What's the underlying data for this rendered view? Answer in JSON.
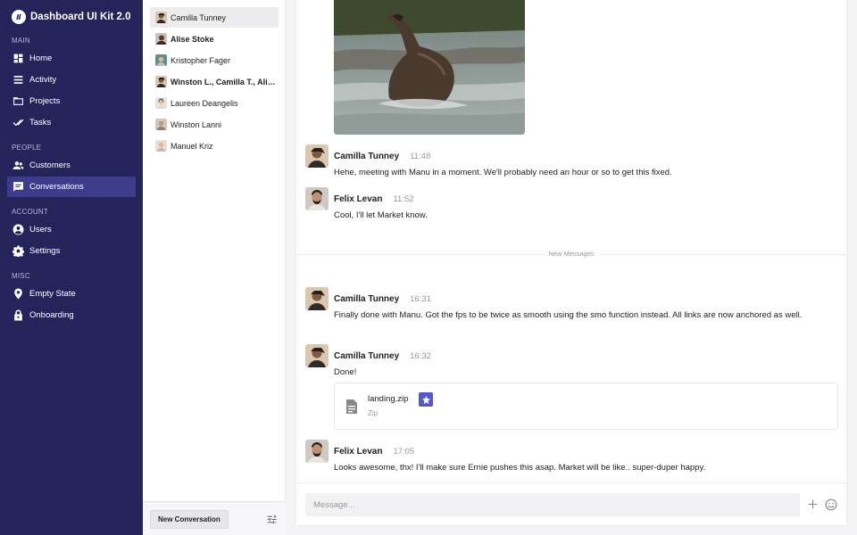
{
  "app": {
    "title": "Dashboard UI Kit 2.0"
  },
  "sidebar": {
    "sections": {
      "main": "MAIN",
      "people": "PEOPLE",
      "account": "ACCOUNT",
      "misc": "MISC"
    },
    "items": [
      {
        "label": "Home",
        "icon": "home-icon"
      },
      {
        "label": "Activity",
        "icon": "activity-icon"
      },
      {
        "label": "Projects",
        "icon": "folder-icon"
      },
      {
        "label": "Tasks",
        "icon": "double-check-icon"
      },
      {
        "label": "Customers",
        "icon": "people-icon"
      },
      {
        "label": "Conversations",
        "icon": "chat-icon",
        "active": true
      },
      {
        "label": "Users",
        "icon": "user-icon"
      },
      {
        "label": "Settings",
        "icon": "gear-icon"
      },
      {
        "label": "Empty State",
        "icon": "pin-icon"
      },
      {
        "label": "Onboarding",
        "icon": "lock-icon"
      }
    ]
  },
  "conversations": {
    "items": [
      {
        "name": "Camilla Tunney",
        "selected": true,
        "unread": false
      },
      {
        "name": "Alise Stoke",
        "unread": true
      },
      {
        "name": "Kristopher Fager",
        "unread": false
      },
      {
        "name": "Winston L., Camilla T., Alis…",
        "unread": true
      },
      {
        "name": "Laureen Deangelis",
        "unread": false
      },
      {
        "name": "Winston Lanni",
        "unread": false
      },
      {
        "name": "Manuel Kriz",
        "unread": false
      }
    ],
    "new_button": "New Conversation"
  },
  "chat": {
    "messages": [
      {
        "author": "Camilla Tunney",
        "time": "11:48",
        "text": "Hehe, meeting with Manu in a moment. We'll probably need an hour or so to get this fixed."
      },
      {
        "author": "Felix Levan",
        "time": "11:52",
        "text": "Cool, I'll let Market know."
      },
      {
        "author": "Camilla Tunney",
        "time": "16:31",
        "text": "Finally done with Manu. Got the fps to be twice as smooth using the smo function instead. All links are now anchored as well."
      },
      {
        "author": "Camilla Tunney",
        "time": "16:32",
        "text": "Done!"
      },
      {
        "author": "Felix Levan",
        "time": "17:05",
        "text": "Looks awesome, thx! I'll make sure Ernie pushes this asap. Market will be like.. super-duper happy."
      }
    ],
    "divider": "New Messages",
    "attachment": {
      "name": "landing.zip",
      "type": "Zip"
    },
    "composer": {
      "placeholder": "Message..."
    }
  },
  "colors": {
    "sidebar_bg": "#25245a",
    "sidebar_active": "#3d3c8a",
    "accent": "#5457c8"
  }
}
